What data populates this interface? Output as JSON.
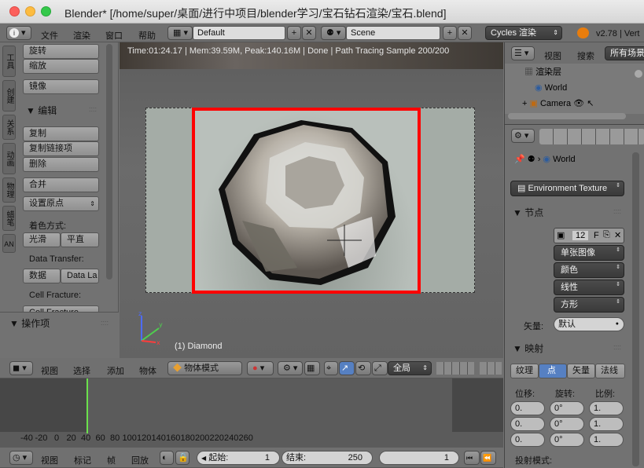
{
  "window": {
    "title": "Blender* [/home/super/桌面/进行中项目/blender学习/宝石钻石渲染/宝石.blend]"
  },
  "topbar": {
    "menus": [
      "文件",
      "渲染",
      "窗口",
      "帮助"
    ],
    "layout": "Default",
    "scene": "Scene",
    "engine": "Cycles 渲染",
    "version": "v2.78 | Vert"
  },
  "toolshelf": {
    "tabs": [
      "工具",
      "创建",
      "关系",
      "动画",
      "物理",
      "蜡笔",
      "AN"
    ],
    "transform": [
      "旋转",
      "缩放"
    ],
    "mirror": "镜像",
    "edit_header": "编辑",
    "edit_btns": [
      "复制",
      "复制链接项",
      "删除"
    ],
    "join": "合并",
    "set_origin": "设置原点",
    "shading_label": "着色方式:",
    "shading_btns": [
      "光滑",
      "平直"
    ],
    "data_transfer_label": "Data Transfer:",
    "data_transfer_btns": [
      "数据",
      "Data La"
    ],
    "cell_fracture_label": "Cell Fracture:",
    "cell_fracture_btn": "Cell Fracture",
    "operator_header": "操作项"
  },
  "viewport": {
    "status": "Time:01:24.17 | Mem:39.59M, Peak:140.16M | Done | Path Tracing Sample 200/200",
    "object_label": "(1) Diamond",
    "menus": [
      "视图",
      "选择",
      "添加",
      "物体"
    ],
    "mode": "物体模式",
    "global": "全局"
  },
  "outliner": {
    "menus": [
      "视图",
      "搜索"
    ],
    "filter": "所有场景",
    "items": [
      "渲染层",
      "World",
      "Camera"
    ]
  },
  "properties": {
    "breadcrumb": "World",
    "env_texture": "Environment Texture",
    "nodes_header": "节点",
    "image_users": "12",
    "image_flag": "F",
    "image_type": "单张图像",
    "color": "颜色",
    "interp": "线性",
    "projection": "方形",
    "vector_label": "矢量:",
    "vector_value": "默认",
    "mapping_header": "映射",
    "mapping_tabs": [
      "纹理",
      "点",
      "矢量",
      "法线"
    ],
    "transform_labels": [
      "位移:",
      "旋转:",
      "比例:"
    ],
    "loc_values": [
      "0.",
      "0.",
      "0."
    ],
    "rot_values": [
      "0°",
      "0°",
      "0°"
    ],
    "scale_values": [
      "1.",
      "1.",
      "1."
    ],
    "projection_label": "投射模式:"
  },
  "timeline": {
    "ticks": [
      "-40",
      "-20",
      "0",
      "20",
      "40",
      "60",
      "80",
      "100",
      "120",
      "140",
      "160",
      "180",
      "200",
      "220",
      "240",
      "260"
    ],
    "menus": [
      "视图",
      "标记",
      "帧",
      "回放"
    ],
    "start_label": "起始:",
    "start": "1",
    "end_label": "结束:",
    "end": "250",
    "current": "1"
  },
  "colors": {
    "accent": "#5680c2",
    "frame_cursor": "#6be04c",
    "highlight": "#ff0000"
  }
}
